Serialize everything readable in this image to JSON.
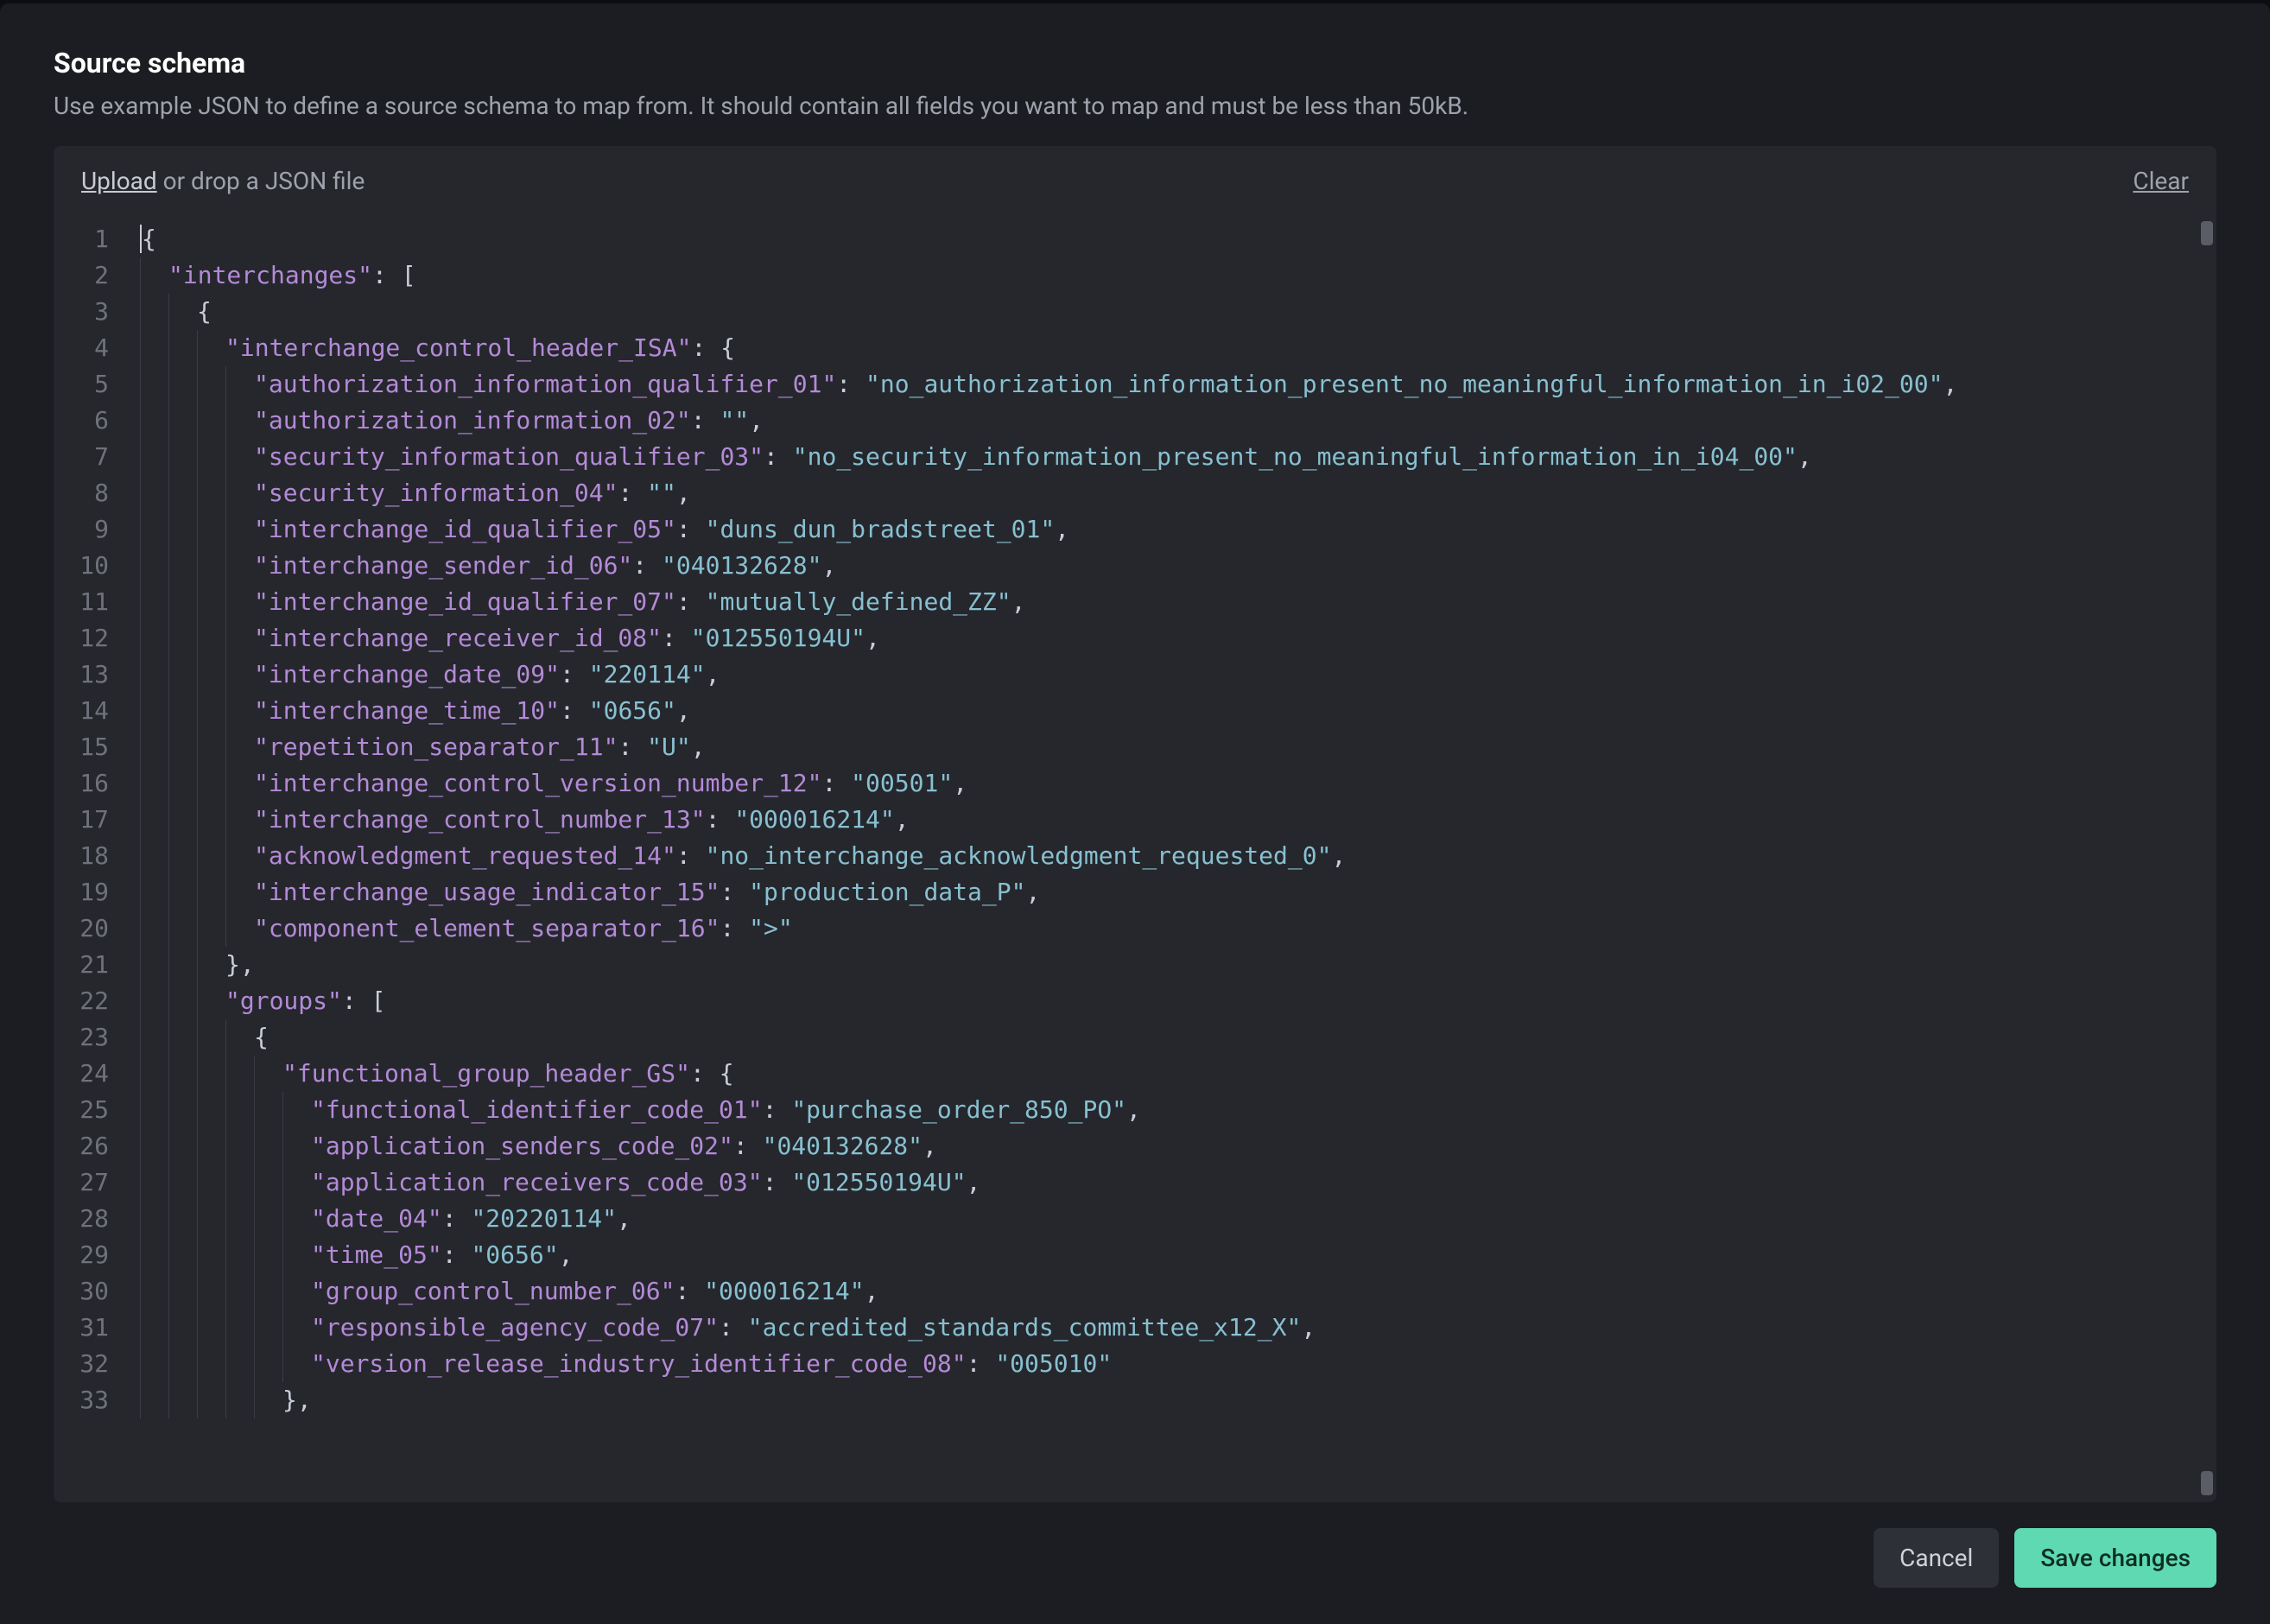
{
  "modal": {
    "title": "Source schema",
    "subtitle": "Use example JSON to define a source schema to map from. It should contain all fields you want to map and must be less than 50kB."
  },
  "toolbar": {
    "upload_link": "Upload",
    "upload_suffix": " or drop a JSON file",
    "clear_link": "Clear"
  },
  "buttons": {
    "cancel": "Cancel",
    "save": "Save changes"
  },
  "editor": {
    "line_numbers": [
      "1",
      "2",
      "3",
      "4",
      "5",
      "6",
      "7",
      "8",
      "9",
      "10",
      "11",
      "12",
      "13",
      "14",
      "15",
      "16",
      "17",
      "18",
      "19",
      "20",
      "21",
      "22",
      "23",
      "24",
      "25",
      "26",
      "27",
      "28",
      "29",
      "30",
      "31",
      "32",
      "33"
    ],
    "lines": [
      [
        {
          "t": "brace",
          "v": "{",
          "cursor": true
        }
      ],
      [
        {
          "t": "ind",
          "n": 1
        },
        {
          "t": "key",
          "v": "\"interchanges\""
        },
        {
          "t": "punct",
          "v": ": ["
        }
      ],
      [
        {
          "t": "ind",
          "n": 2
        },
        {
          "t": "brace",
          "v": "{"
        }
      ],
      [
        {
          "t": "ind",
          "n": 3
        },
        {
          "t": "key",
          "v": "\"interchange_control_header_ISA\""
        },
        {
          "t": "punct",
          "v": ": {"
        }
      ],
      [
        {
          "t": "ind",
          "n": 4
        },
        {
          "t": "key",
          "v": "\"authorization_information_qualifier_01\""
        },
        {
          "t": "punct",
          "v": ": "
        },
        {
          "t": "str",
          "v": "\"no_authorization_information_present_no_meaningful_information_in_i02_00\""
        },
        {
          "t": "punct",
          "v": ","
        }
      ],
      [
        {
          "t": "ind",
          "n": 4
        },
        {
          "t": "key",
          "v": "\"authorization_information_02\""
        },
        {
          "t": "punct",
          "v": ": "
        },
        {
          "t": "str",
          "v": "\"\""
        },
        {
          "t": "punct",
          "v": ","
        }
      ],
      [
        {
          "t": "ind",
          "n": 4
        },
        {
          "t": "key",
          "v": "\"security_information_qualifier_03\""
        },
        {
          "t": "punct",
          "v": ": "
        },
        {
          "t": "str",
          "v": "\"no_security_information_present_no_meaningful_information_in_i04_00\""
        },
        {
          "t": "punct",
          "v": ","
        }
      ],
      [
        {
          "t": "ind",
          "n": 4
        },
        {
          "t": "key",
          "v": "\"security_information_04\""
        },
        {
          "t": "punct",
          "v": ": "
        },
        {
          "t": "str",
          "v": "\"\""
        },
        {
          "t": "punct",
          "v": ","
        }
      ],
      [
        {
          "t": "ind",
          "n": 4
        },
        {
          "t": "key",
          "v": "\"interchange_id_qualifier_05\""
        },
        {
          "t": "punct",
          "v": ": "
        },
        {
          "t": "str",
          "v": "\"duns_dun_bradstreet_01\""
        },
        {
          "t": "punct",
          "v": ","
        }
      ],
      [
        {
          "t": "ind",
          "n": 4
        },
        {
          "t": "key",
          "v": "\"interchange_sender_id_06\""
        },
        {
          "t": "punct",
          "v": ": "
        },
        {
          "t": "str",
          "v": "\"040132628\""
        },
        {
          "t": "punct",
          "v": ","
        }
      ],
      [
        {
          "t": "ind",
          "n": 4
        },
        {
          "t": "key",
          "v": "\"interchange_id_qualifier_07\""
        },
        {
          "t": "punct",
          "v": ": "
        },
        {
          "t": "str",
          "v": "\"mutually_defined_ZZ\""
        },
        {
          "t": "punct",
          "v": ","
        }
      ],
      [
        {
          "t": "ind",
          "n": 4
        },
        {
          "t": "key",
          "v": "\"interchange_receiver_id_08\""
        },
        {
          "t": "punct",
          "v": ": "
        },
        {
          "t": "str",
          "v": "\"012550194U\""
        },
        {
          "t": "punct",
          "v": ","
        }
      ],
      [
        {
          "t": "ind",
          "n": 4
        },
        {
          "t": "key",
          "v": "\"interchange_date_09\""
        },
        {
          "t": "punct",
          "v": ": "
        },
        {
          "t": "str",
          "v": "\"220114\""
        },
        {
          "t": "punct",
          "v": ","
        }
      ],
      [
        {
          "t": "ind",
          "n": 4
        },
        {
          "t": "key",
          "v": "\"interchange_time_10\""
        },
        {
          "t": "punct",
          "v": ": "
        },
        {
          "t": "str",
          "v": "\"0656\""
        },
        {
          "t": "punct",
          "v": ","
        }
      ],
      [
        {
          "t": "ind",
          "n": 4
        },
        {
          "t": "key",
          "v": "\"repetition_separator_11\""
        },
        {
          "t": "punct",
          "v": ": "
        },
        {
          "t": "str",
          "v": "\"U\""
        },
        {
          "t": "punct",
          "v": ","
        }
      ],
      [
        {
          "t": "ind",
          "n": 4
        },
        {
          "t": "key",
          "v": "\"interchange_control_version_number_12\""
        },
        {
          "t": "punct",
          "v": ": "
        },
        {
          "t": "str",
          "v": "\"00501\""
        },
        {
          "t": "punct",
          "v": ","
        }
      ],
      [
        {
          "t": "ind",
          "n": 4
        },
        {
          "t": "key",
          "v": "\"interchange_control_number_13\""
        },
        {
          "t": "punct",
          "v": ": "
        },
        {
          "t": "str",
          "v": "\"000016214\""
        },
        {
          "t": "punct",
          "v": ","
        }
      ],
      [
        {
          "t": "ind",
          "n": 4
        },
        {
          "t": "key",
          "v": "\"acknowledgment_requested_14\""
        },
        {
          "t": "punct",
          "v": ": "
        },
        {
          "t": "str",
          "v": "\"no_interchange_acknowledgment_requested_0\""
        },
        {
          "t": "punct",
          "v": ","
        }
      ],
      [
        {
          "t": "ind",
          "n": 4
        },
        {
          "t": "key",
          "v": "\"interchange_usage_indicator_15\""
        },
        {
          "t": "punct",
          "v": ": "
        },
        {
          "t": "str",
          "v": "\"production_data_P\""
        },
        {
          "t": "punct",
          "v": ","
        }
      ],
      [
        {
          "t": "ind",
          "n": 4
        },
        {
          "t": "key",
          "v": "\"component_element_separator_16\""
        },
        {
          "t": "punct",
          "v": ": "
        },
        {
          "t": "str",
          "v": "\">\""
        }
      ],
      [
        {
          "t": "ind",
          "n": 3
        },
        {
          "t": "punct",
          "v": "},"
        }
      ],
      [
        {
          "t": "ind",
          "n": 3
        },
        {
          "t": "key",
          "v": "\"groups\""
        },
        {
          "t": "punct",
          "v": ": ["
        }
      ],
      [
        {
          "t": "ind",
          "n": 4
        },
        {
          "t": "brace",
          "v": "{"
        }
      ],
      [
        {
          "t": "ind",
          "n": 5
        },
        {
          "t": "key",
          "v": "\"functional_group_header_GS\""
        },
        {
          "t": "punct",
          "v": ": {"
        }
      ],
      [
        {
          "t": "ind",
          "n": 6
        },
        {
          "t": "key",
          "v": "\"functional_identifier_code_01\""
        },
        {
          "t": "punct",
          "v": ": "
        },
        {
          "t": "str",
          "v": "\"purchase_order_850_PO\""
        },
        {
          "t": "punct",
          "v": ","
        }
      ],
      [
        {
          "t": "ind",
          "n": 6
        },
        {
          "t": "key",
          "v": "\"application_senders_code_02\""
        },
        {
          "t": "punct",
          "v": ": "
        },
        {
          "t": "str",
          "v": "\"040132628\""
        },
        {
          "t": "punct",
          "v": ","
        }
      ],
      [
        {
          "t": "ind",
          "n": 6
        },
        {
          "t": "key",
          "v": "\"application_receivers_code_03\""
        },
        {
          "t": "punct",
          "v": ": "
        },
        {
          "t": "str",
          "v": "\"012550194U\""
        },
        {
          "t": "punct",
          "v": ","
        }
      ],
      [
        {
          "t": "ind",
          "n": 6
        },
        {
          "t": "key",
          "v": "\"date_04\""
        },
        {
          "t": "punct",
          "v": ": "
        },
        {
          "t": "str",
          "v": "\"20220114\""
        },
        {
          "t": "punct",
          "v": ","
        }
      ],
      [
        {
          "t": "ind",
          "n": 6
        },
        {
          "t": "key",
          "v": "\"time_05\""
        },
        {
          "t": "punct",
          "v": ": "
        },
        {
          "t": "str",
          "v": "\"0656\""
        },
        {
          "t": "punct",
          "v": ","
        }
      ],
      [
        {
          "t": "ind",
          "n": 6
        },
        {
          "t": "key",
          "v": "\"group_control_number_06\""
        },
        {
          "t": "punct",
          "v": ": "
        },
        {
          "t": "str",
          "v": "\"000016214\""
        },
        {
          "t": "punct",
          "v": ","
        }
      ],
      [
        {
          "t": "ind",
          "n": 6
        },
        {
          "t": "key",
          "v": "\"responsible_agency_code_07\""
        },
        {
          "t": "punct",
          "v": ": "
        },
        {
          "t": "str",
          "v": "\"accredited_standards_committee_x12_X\""
        },
        {
          "t": "punct",
          "v": ","
        }
      ],
      [
        {
          "t": "ind",
          "n": 6
        },
        {
          "t": "key",
          "v": "\"version_release_industry_identifier_code_08\""
        },
        {
          "t": "punct",
          "v": ": "
        },
        {
          "t": "str",
          "v": "\"005010\""
        }
      ],
      [
        {
          "t": "ind",
          "n": 5
        },
        {
          "t": "punct",
          "v": "},"
        }
      ]
    ]
  }
}
